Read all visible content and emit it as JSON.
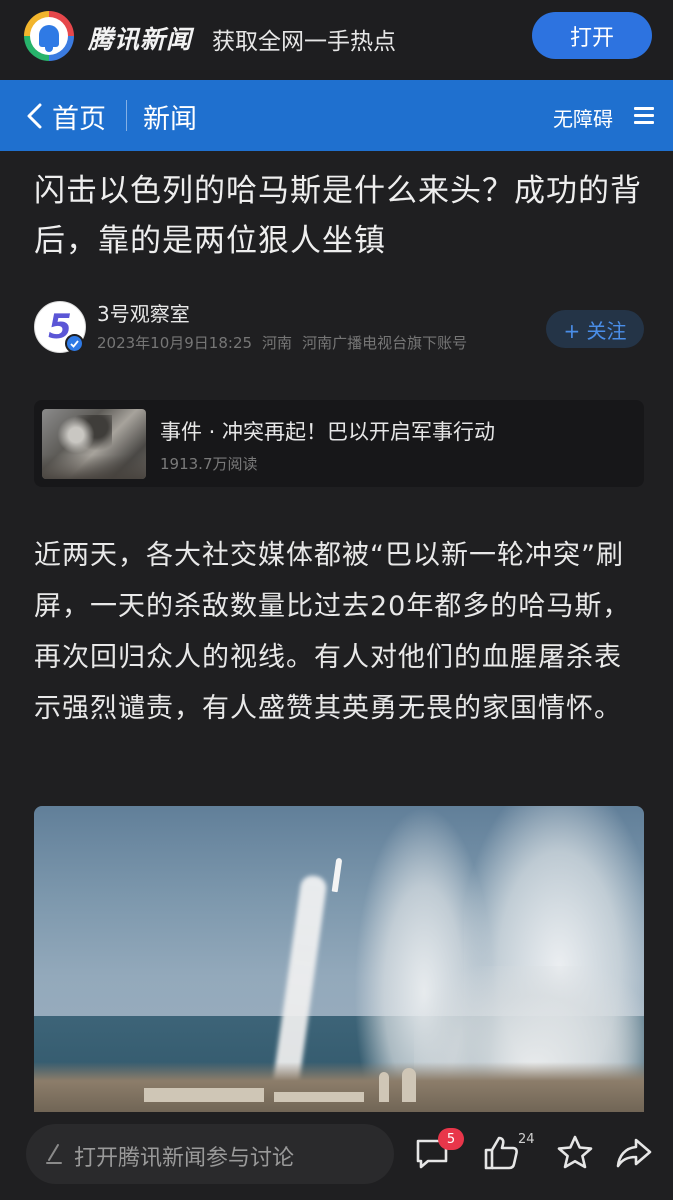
{
  "promo": {
    "app_name": "腾讯新闻",
    "slogan": "获取全网一手热点",
    "open_button": "打开"
  },
  "nav": {
    "home": "首页",
    "section": "新闻",
    "accessibility": "无障碍"
  },
  "article": {
    "title": "闪击以色列的哈马斯是什么来头？成功的背后，靠的是两位狠人坐镇",
    "author": {
      "name": "3号观察室",
      "datetime": "2023年10月9日18:25",
      "location": "河南",
      "org": "河南广播电视台旗下账号",
      "follow_button": "+ 关注"
    },
    "event": {
      "title": "事件 · 冲突再起！巴以开启军事行动",
      "reads": "1913.7万阅读"
    },
    "body": "近两天，各大社交媒体都被“巴以新一轮冲突”刷屏，一天的杀敌数量比过去20年都多的哈马斯，再次回归众人的视线。有人对他们的血腥屠杀表示强烈谴责，有人盛赞其英勇无畏的家国情怀。"
  },
  "toolbar": {
    "comment_placeholder": "打开腾讯新闻参与讨论",
    "comment_count": "5",
    "like_count": "24"
  },
  "icons": {
    "back": "chevron-left-icon",
    "menu": "hamburger-menu-icon",
    "verified": "check-icon",
    "comment": "comment-icon",
    "like": "thumbs-up-icon",
    "favorite": "star-icon",
    "share": "share-icon",
    "pen": "pen-icon"
  },
  "colors": {
    "brand_blue": "#1f70cf",
    "button_blue": "#2d73e0",
    "background": "#1f1f21",
    "badge_red": "#e8364a"
  }
}
